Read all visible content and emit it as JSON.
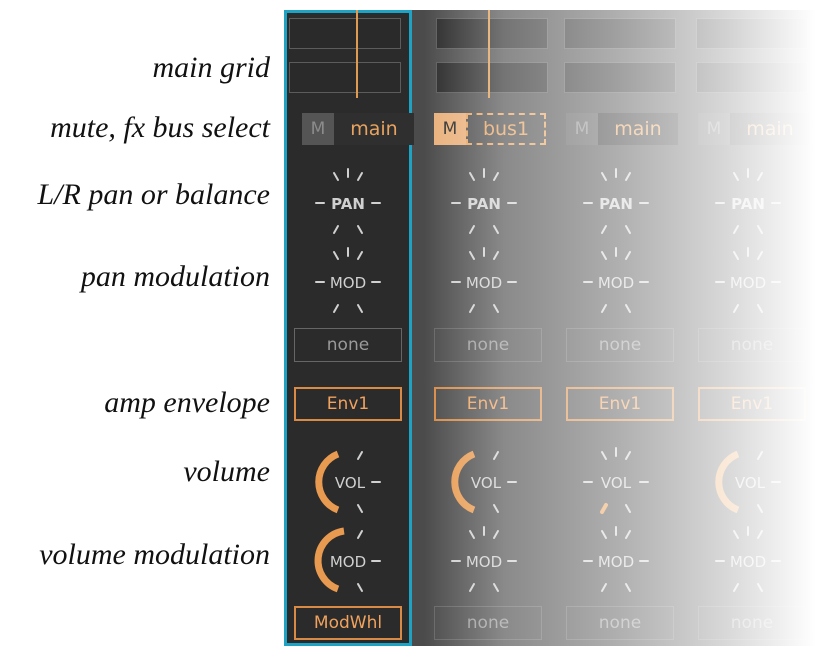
{
  "labels": {
    "main_grid": "main grid",
    "mute_fx": "mute, fx bus select",
    "pan": "L/R pan or balance",
    "pan_mod": "pan modulation",
    "amp_env": "amp envelope",
    "volume": "volume",
    "volume_mod": "volume modulation"
  },
  "mixer": {
    "pan_knob_label": "PAN",
    "mod_knob_label": "MOD",
    "vol_knob_label": "VOL",
    "mute_label": "M",
    "channels": [
      {
        "bus": "main",
        "muted": false,
        "pan_mod": "none",
        "envelope": "Env1",
        "vol_mod": "ModWhl"
      },
      {
        "bus": "bus1",
        "muted": true,
        "pan_mod": "none",
        "envelope": "Env1",
        "vol_mod": "none"
      },
      {
        "bus": "main",
        "muted": false,
        "pan_mod": "none",
        "envelope": "Env1",
        "vol_mod": "none"
      },
      {
        "bus": "main",
        "muted": false,
        "pan_mod": "none",
        "envelope": "Env1",
        "vol_mod": "none"
      }
    ]
  },
  "colors": {
    "accent": "#e7a35f",
    "selection": "#1fa3c4",
    "panel": "#2b2b2b"
  }
}
